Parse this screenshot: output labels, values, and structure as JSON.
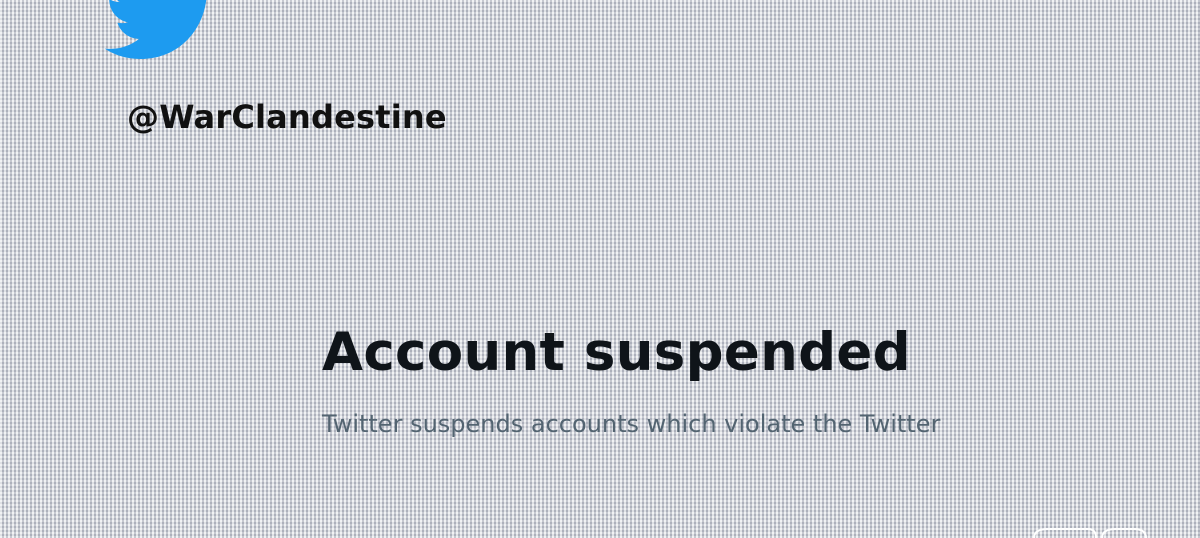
{
  "profile": {
    "logo_icon": "twitter-bird-icon",
    "brand_color": "#1d9bf0",
    "handle": "@WarClandestine"
  },
  "notice": {
    "title": "Account suspended",
    "description": "Twitter suspends accounts which violate the Twitter"
  }
}
